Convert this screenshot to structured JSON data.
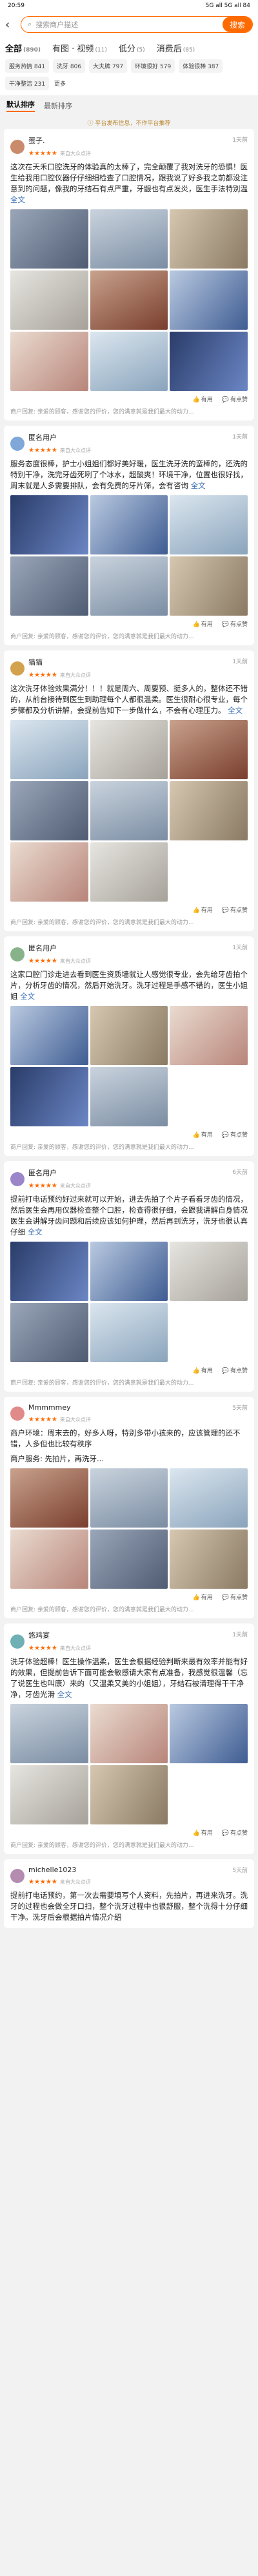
{
  "status": {
    "time": "20:59",
    "right": "5G all 5G all 84"
  },
  "search": {
    "placeholder": "搜索商户描述",
    "button": "搜索"
  },
  "filter_tabs": [
    {
      "label": "全部",
      "count": "(890)"
    },
    {
      "label": "有图 · 视频",
      "count": "(11)"
    },
    {
      "label": "低分",
      "count": "(5)"
    },
    {
      "label": "消费后",
      "count": "(85)"
    }
  ],
  "chips": [
    "服务热情 841",
    "洗牙 806",
    "大夫牌 797",
    "环境很好 579",
    "体验很棒 387",
    "干净整洁 231"
  ],
  "chips_more": "更多",
  "sort": [
    "默认排序",
    "最新排序"
  ],
  "notice": "平台发布信息，不作平台推荐",
  "reviews": [
    {
      "user": "蛋子.",
      "time": "1天前",
      "stars": "★★★★★",
      "source": "来自大众点评",
      "text": "这次在天禾口腔洗牙的体验真的太棒了，完全颠覆了我对洗牙的恐惧！医生给我用口腔仪器仔仔细细检查了口腔情况，跟我说了好多我之前都没注意到的问题，像我的牙结石有点严重，牙龈也有点发炎，医生手法特别温",
      "more": "全文",
      "photos": [
        "p1",
        "p2",
        "p3",
        "p4",
        "p5",
        "p6",
        "p7",
        "p8",
        "p9"
      ],
      "useful": "有用",
      "comment": "有点赞",
      "merchant": "商户回复: 亲爱的顾客，感谢您的评价，您的满意就是我们最大的动力..."
    },
    {
      "user": "匿名用户",
      "time": "1天前",
      "stars": "★★★★★",
      "source": "来自大众点评",
      "text": "服务态度很棒，护士小姐姐们都好美好暖，医生洗牙洗的蛮棒的，还洗的特别干净，洗完牙齿死咧了个冰水，超酸爽！环境干净，位置也很好找，周末就是人多需要排队，会有免费的牙片筛，会有咨询",
      "more": "全文",
      "photos": [
        "p9",
        "p6",
        "p8",
        "p1",
        "p2",
        "p3"
      ],
      "useful": "有用",
      "comment": "有点赞",
      "merchant": "商户回复: 亲爱的顾客，感谢您的评价，您的满意就是我们最大的动力..."
    },
    {
      "user": "猫猫",
      "time": "1天前",
      "stars": "★★★★★",
      "source": "来自大众点评",
      "text": "这次洗牙体验效果满分！！！就是周六、周要预、挺多人的，整体还不错的，从前台接待到医生到助理每个人都很温柔。医生很耐心很专业，每个步骤都及分析讲解，会提前告知下一步做什么，不会有心理压力。",
      "more": "全文",
      "photos": [
        "p8",
        "p4",
        "p5",
        "p1",
        "p2",
        "p3",
        "p7",
        "p4"
      ],
      "useful": "有用",
      "comment": "有点赞",
      "merchant": "商户回复: 亲爱的顾客，感谢您的评价，您的满意就是我们最大的动力..."
    },
    {
      "user": "匿名用户",
      "time": "1天前",
      "stars": "★★★★★",
      "source": "来自大众点评",
      "text": "这家口腔门诊走进去看到医生资质墙就让人感觉很专业，会先给牙齿拍个片，分析牙齿的情况，然后开始洗牙。洗牙过程是手感不错的，医生小姐姐",
      "more": "全文",
      "photos": [
        "p6",
        "p3",
        "p7",
        "p9",
        "p2"
      ],
      "useful": "有用",
      "comment": "有点赞",
      "merchant": "商户回复: 亲爱的顾客，感谢您的评价，您的满意就是我们最大的动力..."
    },
    {
      "user": "匿名用户",
      "time": "6天前",
      "stars": "★★★★★",
      "source": "来自大众点评",
      "text": "提前打电话预约好过来就可以开始，进去先拍了个片子看看牙齿的情况，然后医生会再用仪器检查整个口腔，检查得很仔细，会跟我讲解自身情况医生会讲解牙齿问题和后续应该如何护理，然后再到洗牙，洗牙也很认真仔细",
      "more": "全文",
      "photos": [
        "p9",
        "p6",
        "p4",
        "p1",
        "p8"
      ],
      "useful": "有用",
      "comment": "有点赞",
      "merchant": "商户回复: 亲爱的顾客，感谢您的评价，您的满意就是我们最大的动力..."
    },
    {
      "user": "Mmmmmey",
      "time": "5天前",
      "stars": "★★★★★",
      "source": "来自大众点评",
      "text": "商户环境：周末去的，好多人呀，特别多带小孩来的，应该管理的还不错，人多但也比较有秩序",
      "more": "",
      "merchant_tag": "商户服务: 先拍片，再洗牙...",
      "photos": [
        "p5",
        "p2",
        "p8",
        "p7",
        "p1",
        "p3"
      ],
      "useful": "有用",
      "comment": "有点赞",
      "merchant": "商户回复: 亲爱的顾客，感谢您的评价，您的满意就是我们最大的动力..."
    },
    {
      "user": "悠鸡宴",
      "time": "1天前",
      "stars": "★★★★★",
      "source": "来自大众点评",
      "text": "洗牙体验超棒！医生操作温柔，医生会根据经验判断来最有效率并能有好的效果，但提前告诉下面可能会敏感请大家有点准备，我感觉很温馨（忘了说医生也叫康）来的（又温柔又美的小姐姐），牙结石被清理得干干净净，牙齿光滑",
      "more": "全文",
      "photos": [
        "p2",
        "p7",
        "p6",
        "p4",
        "p3"
      ],
      "useful": "有用",
      "comment": "有点赞",
      "merchant": "商户回复: 亲爱的顾客，感谢您的评价，您的满意就是我们最大的动力..."
    },
    {
      "user": "michelle1023",
      "time": "5天前",
      "stars": "★★★★★",
      "source": "来自大众点评",
      "text": "提前打电话预约，第一次去需要填写个人资料，先拍片，再进来洗牙。洗牙的过程也会做全牙口扫，整个洗牙过程中也很舒服，整个洗得十分仔细干净。洗牙后会根据拍片情况介绍",
      "more": "",
      "photos": [],
      "useful": "",
      "comment": "",
      "merchant": ""
    }
  ]
}
